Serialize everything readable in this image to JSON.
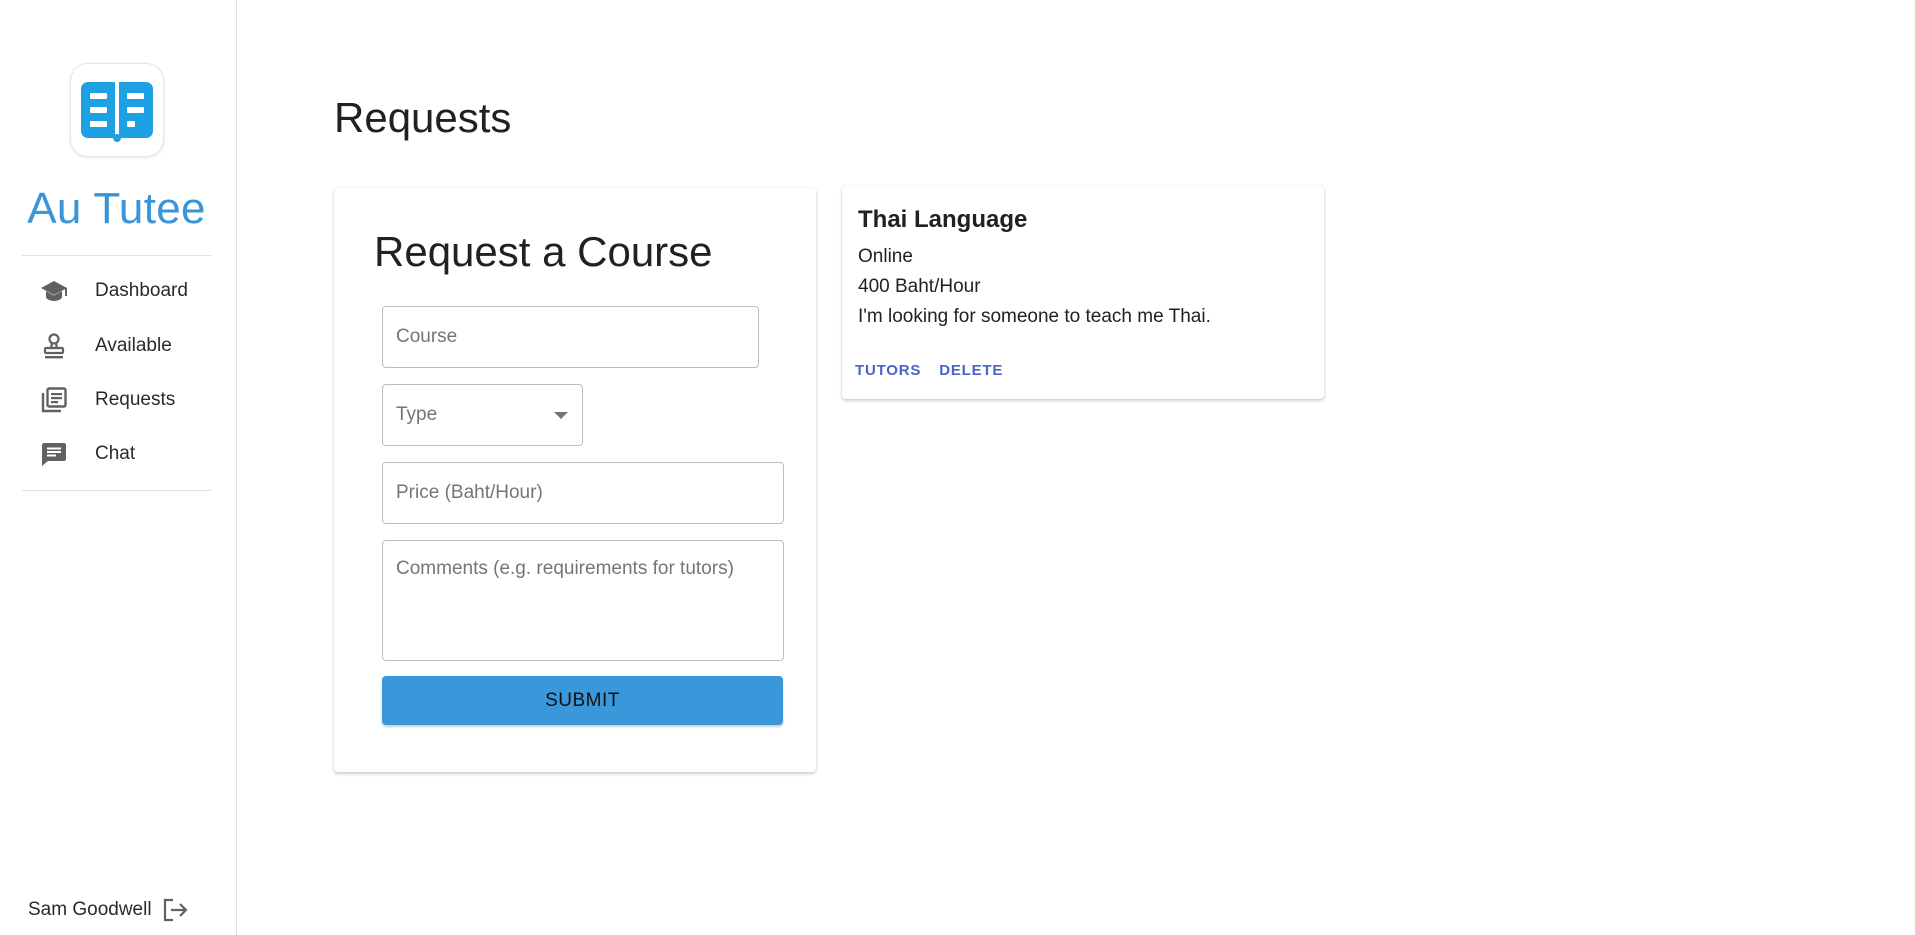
{
  "app": {
    "name": "Au Tutee"
  },
  "sidebar": {
    "items": [
      {
        "label": "Dashboard",
        "icon": "graduation-cap-icon"
      },
      {
        "label": "Available",
        "icon": "stamp-icon"
      },
      {
        "label": "Requests",
        "icon": "library-books-icon"
      },
      {
        "label": "Chat",
        "icon": "chat-bubble-icon"
      }
    ],
    "user": {
      "name": "Sam Goodwell",
      "logout_icon": "logout-icon"
    }
  },
  "main": {
    "title": "Requests",
    "form": {
      "title": "Request a Course",
      "course_placeholder": "Course",
      "type_label": "Type",
      "price_placeholder": "Price (Baht/Hour)",
      "comments_placeholder": "Comments (e.g. requirements for tutors)",
      "submit_label": "SUBMIT"
    },
    "requests": [
      {
        "title": "Thai Language",
        "type": "Online",
        "price": "400 Baht/Hour",
        "comment": "I'm looking for someone to teach me Thai.",
        "tutors_label": "TUTORS",
        "delete_label": "DELETE"
      }
    ]
  },
  "colors": {
    "brand": "#3a95d8",
    "submit": "#3a97d9",
    "action_text": "#4a63c8",
    "icon": "#616161"
  }
}
